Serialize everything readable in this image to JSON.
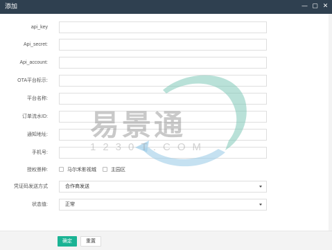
{
  "window": {
    "title": "添加"
  },
  "controls": [
    "—",
    "▢",
    "✕"
  ],
  "form": {
    "fields": [
      {
        "label": "api_key",
        "value": ""
      },
      {
        "label": "Api_secret:",
        "value": ""
      },
      {
        "label": "Api_account:",
        "value": ""
      },
      {
        "label": "OTA平台标示:",
        "value": ""
      },
      {
        "label": "平台名称:",
        "value": ""
      },
      {
        "label": "订单流水ID:",
        "value": ""
      },
      {
        "label": "通知地址:",
        "value": ""
      },
      {
        "label": "手机号:",
        "value": ""
      }
    ],
    "auth_label": "授权景种:",
    "auth_options": [
      "马尔禾影视城",
      "主园区"
    ],
    "voucher_label": "凭证码发送方式",
    "voucher_value": "合作商发送",
    "status_label": "状态值:",
    "status_value": "正常"
  },
  "watermark": {
    "text_main": "易景通",
    "text_sub": "1230T.COM"
  },
  "footer": {
    "confirm": "确定",
    "reset": "重置"
  }
}
